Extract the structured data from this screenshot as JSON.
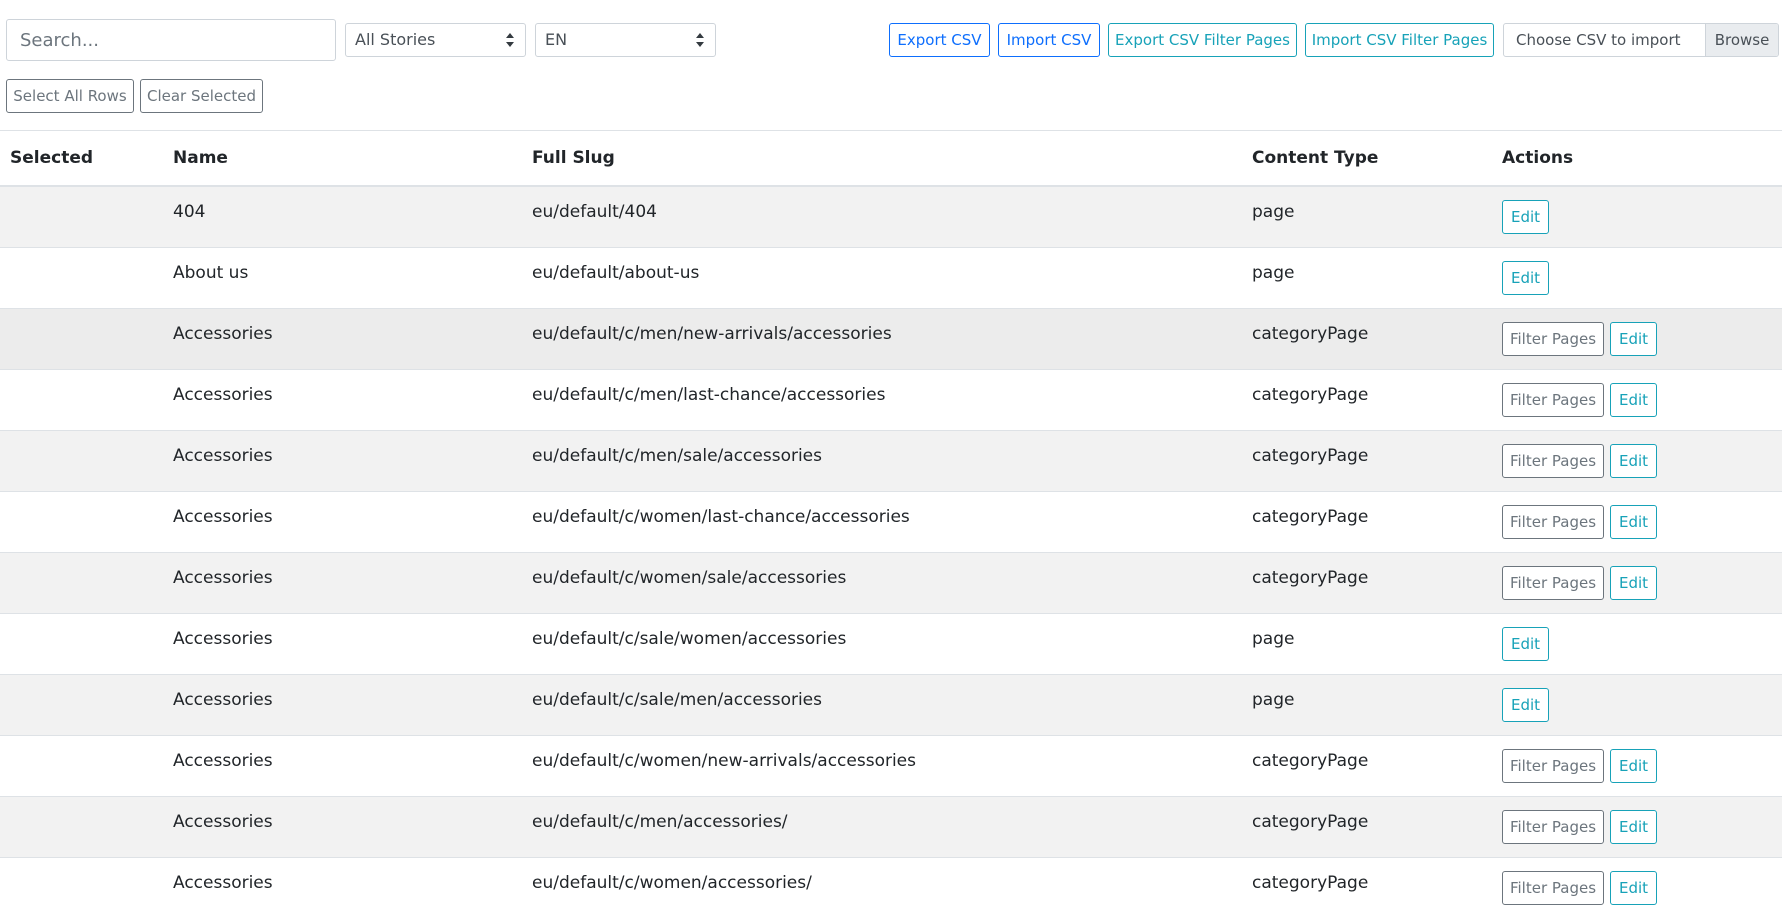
{
  "toolbar": {
    "search_placeholder": "Search...",
    "stories_select": "All Stories",
    "language_select": "EN",
    "export_csv": "Export CSV",
    "import_csv": "Import CSV",
    "export_filter": "Export CSV Filter Pages",
    "import_filter": "Import CSV Filter Pages",
    "file_label": "Choose CSV to import",
    "file_browse": "Browse"
  },
  "selection": {
    "select_all": "Select All Rows",
    "clear": "Clear Selected"
  },
  "table": {
    "headers": [
      "Selected",
      "Name",
      "Full Slug",
      "Content Type",
      "Actions"
    ],
    "filter_label": "Filter Pages",
    "edit_label": "Edit",
    "rows": [
      {
        "name": "404",
        "slug": "eu/default/404",
        "type": "page"
      },
      {
        "name": "About us",
        "slug": "eu/default/about-us",
        "type": "page"
      },
      {
        "name": "Accessories",
        "slug": "eu/default/c/men/new-arrivals/accessories",
        "type": "categoryPage"
      },
      {
        "name": "Accessories",
        "slug": "eu/default/c/men/last-chance/accessories",
        "type": "categoryPage"
      },
      {
        "name": "Accessories",
        "slug": "eu/default/c/men/sale/accessories",
        "type": "categoryPage"
      },
      {
        "name": "Accessories",
        "slug": "eu/default/c/women/last-chance/accessories",
        "type": "categoryPage"
      },
      {
        "name": "Accessories",
        "slug": "eu/default/c/women/sale/accessories",
        "type": "categoryPage"
      },
      {
        "name": "Accessories",
        "slug": "eu/default/c/sale/women/accessories",
        "type": "page"
      },
      {
        "name": "Accessories",
        "slug": "eu/default/c/sale/men/accessories",
        "type": "page"
      },
      {
        "name": "Accessories",
        "slug": "eu/default/c/women/new-arrivals/accessories",
        "type": "categoryPage"
      },
      {
        "name": "Accessories",
        "slug": "eu/default/c/men/accessories/",
        "type": "categoryPage"
      },
      {
        "name": "Accessories",
        "slug": "eu/default/c/women/accessories/",
        "type": "categoryPage"
      }
    ]
  },
  "colors": {
    "primary": "#0d6efd",
    "info": "#17a2b8",
    "secondary": "#6c757d",
    "stripe": "#f2f2f2"
  }
}
